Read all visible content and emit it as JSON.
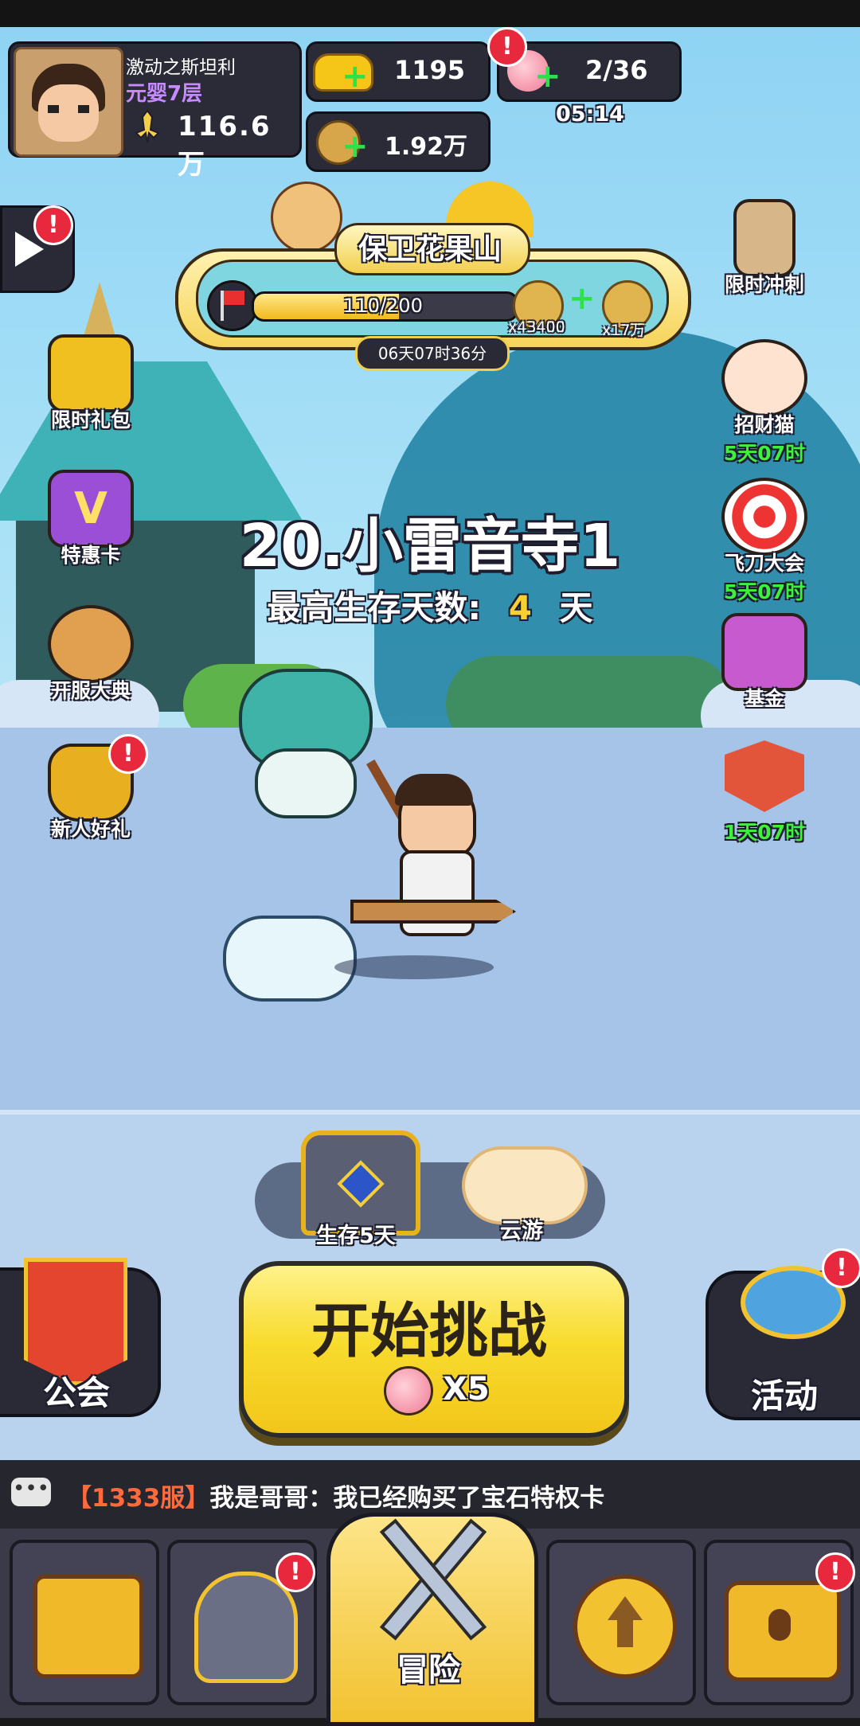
{
  "player": {
    "name": "激动之斯坦利",
    "realm": "元婴7层",
    "power": "116.6万"
  },
  "currency": {
    "gold": "1195",
    "coins": "1.92万",
    "stamina": "2/36",
    "stamina_timer": "05:14"
  },
  "event": {
    "title": "保卫花果山",
    "progress_text": "110/200",
    "progress_ratio": 0.55,
    "reward1": "x43400",
    "reward2": "x17万",
    "countdown": "06天07时36分"
  },
  "left_icons": [
    {
      "label": "限时礼包",
      "color": "#f0c020"
    },
    {
      "label": "特惠卡",
      "color": "#9b4fd6"
    },
    {
      "label": "开服大典",
      "color": "#e0a050"
    },
    {
      "label": "新人好礼",
      "color": "#e8b020"
    }
  ],
  "right_icons": [
    {
      "label": "限时冲刺",
      "timer": ""
    },
    {
      "label": "招财猫",
      "timer": "5天07时"
    },
    {
      "label": "飞刀大会",
      "timer": "5天07时"
    },
    {
      "label": "基金",
      "timer": ""
    },
    {
      "label": "",
      "timer": "1天07时"
    }
  ],
  "stage": {
    "name": "20.小雷音寺1",
    "best_label": "最高生存天数:",
    "best_value": "4",
    "best_unit": "天"
  },
  "chest": {
    "label": "生存5天"
  },
  "cloud": {
    "label": "云游"
  },
  "start": {
    "label": "开始挑战",
    "cost": "X5"
  },
  "guild": {
    "label": "公会"
  },
  "activity": {
    "label": "活动"
  },
  "chat": {
    "server": "【1333服】",
    "message": "我是哥哥：我已经购买了宝石特权卡"
  },
  "tabs": {
    "adventure": "冒险"
  },
  "colors": {
    "accent_yellow": "#f7d032",
    "timer_green": "#3cf23c",
    "badge_red": "#e8283c",
    "chat_server": "#ff6a3d"
  }
}
